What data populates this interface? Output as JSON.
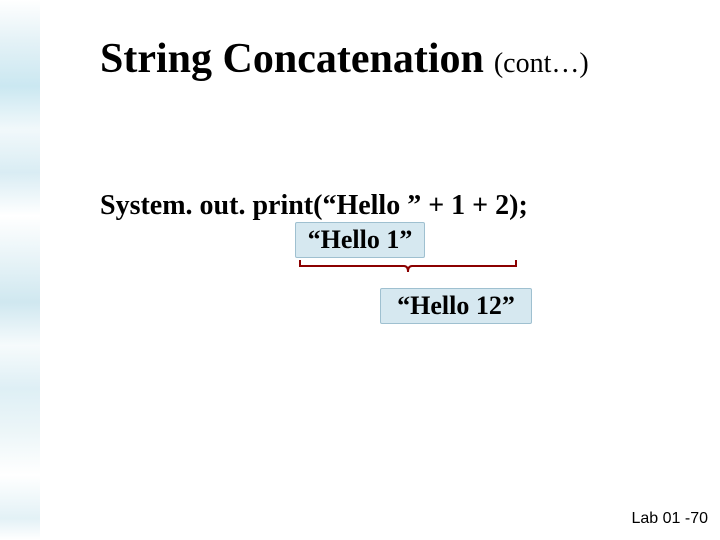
{
  "title": {
    "main": "String Concatenation",
    "cont": "(cont…)"
  },
  "code": "System. out. print(“Hello ” + 1 + 2);",
  "step1": "“Hello 1”",
  "step2": "“Hello 12”",
  "footer": "Lab 01 -70"
}
